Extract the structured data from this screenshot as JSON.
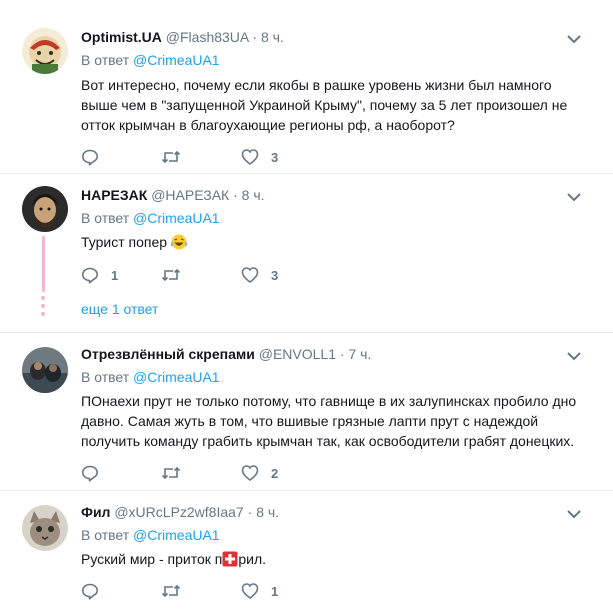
{
  "tweets": [
    {
      "name": "Optimist.UA",
      "handle": "@Flash83UA",
      "dot": "·",
      "time": "8 ч.",
      "reply_prefix": "В ответ",
      "reply_to": "@CrimeaUA1",
      "text": "Вот интересно, почему если якобы в рашке уровень жизни был намного выше чем в \"запущенной Украиной Крыму\", почему за 5 лет произошел не отток крымчан в благоухающие регионы рф, а наоборот?",
      "replies": "",
      "retweets": "",
      "likes": "3"
    },
    {
      "name": "НАРЕЗАК",
      "handle": "@НАРЕЗАК",
      "dot": "·",
      "time": "8 ч.",
      "reply_prefix": "В ответ",
      "reply_to": "@CrimeaUA1",
      "text": "Турист попер",
      "replies": "1",
      "retweets": "",
      "likes": "3",
      "more_replies": "еще 1 ответ"
    },
    {
      "name": "Отрезвлённый скрепами",
      "handle": "@ENVOLL1",
      "dot": "·",
      "time": "7 ч.",
      "reply_prefix": "В ответ",
      "reply_to": "@CrimeaUA1",
      "text": "ПОнаехи прут не только потому, что гавнище в их залупинсках пробило дно давно. Самая жуть в том, что вшивые грязные лапти прут с надеждой получить команду грабить крымчан так, как освободители грабят донецких.",
      "replies": "",
      "retweets": "",
      "likes": "2"
    },
    {
      "name": "Фил",
      "handle": "@xURcLPz2wf8Iaa7",
      "dot": "·",
      "time": "8 ч.",
      "reply_prefix": "В ответ",
      "reply_to": "@CrimeaUA1",
      "text_before": "Руский мир - приток п",
      "text_after": "рил.",
      "replies": "",
      "retweets": "",
      "likes": "1"
    }
  ],
  "icons": {
    "reply": "reply-icon",
    "retweet": "retweet-icon",
    "like": "heart-icon",
    "more": "chevron-down-icon"
  },
  "colors": {
    "link": "#1da1f2",
    "muted": "#657786",
    "thread": "#f5b3cf",
    "border": "#e6ecf0"
  }
}
